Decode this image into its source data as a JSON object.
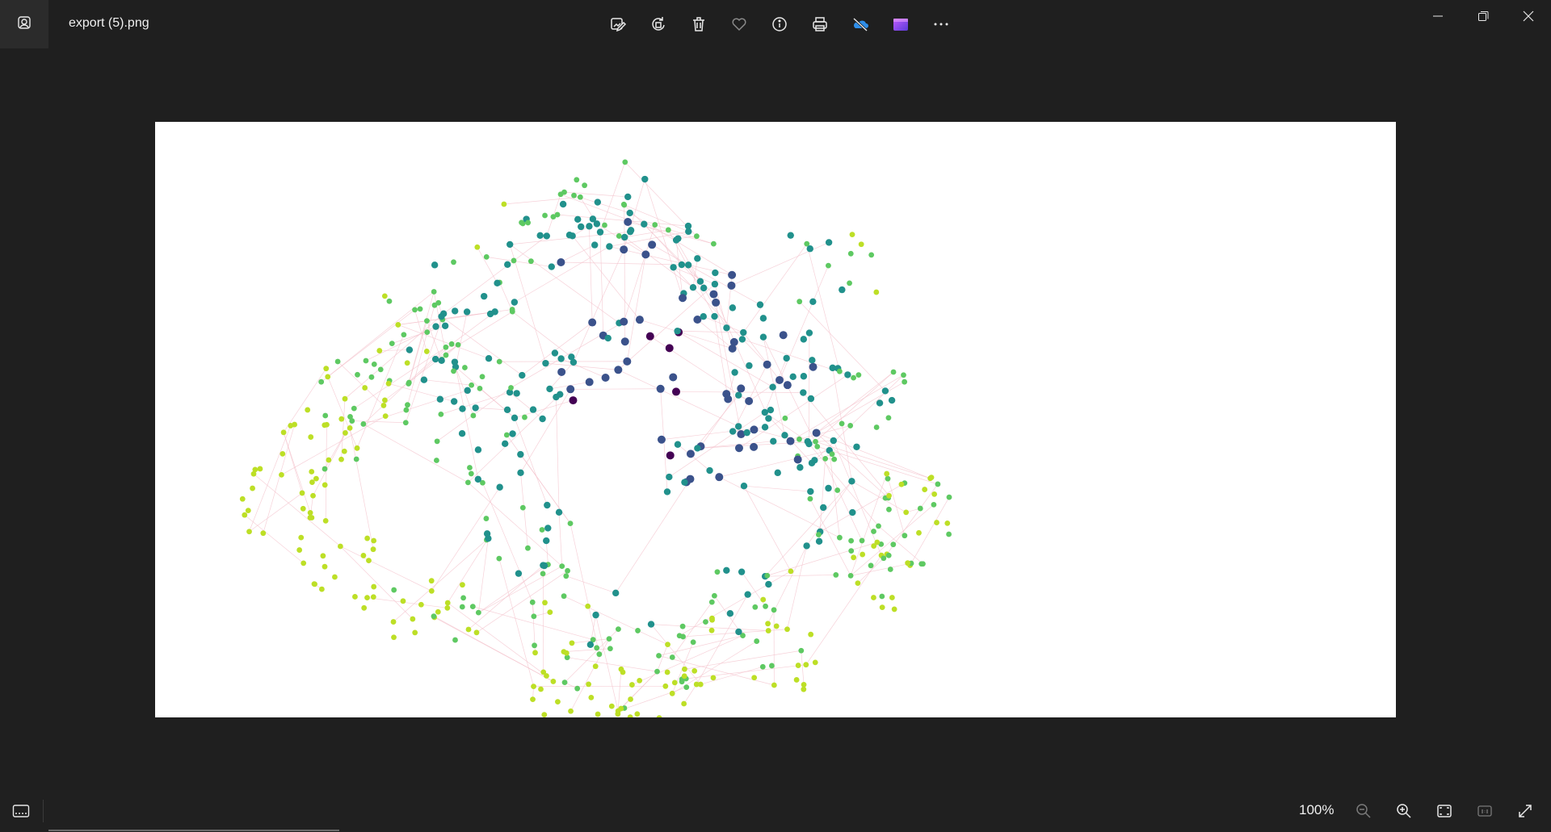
{
  "app": {
    "filename": "export (5).png",
    "icon": "photos-app-icon"
  },
  "toolbar": {
    "items": [
      {
        "name": "edit-image-icon"
      },
      {
        "name": "rotate-icon"
      },
      {
        "name": "delete-icon"
      },
      {
        "name": "favorite-icon"
      },
      {
        "name": "info-icon"
      },
      {
        "name": "print-icon"
      },
      {
        "name": "onedrive-icon"
      },
      {
        "name": "clipchamp-icon"
      },
      {
        "name": "more-options-icon"
      }
    ]
  },
  "window_controls": [
    "minimize-icon",
    "maximize-icon",
    "close-icon"
  ],
  "image": {
    "content": "network graph visualization",
    "node_palette": [
      "#440154",
      "#3b528b",
      "#21918c",
      "#5ec962",
      "#bddf26"
    ],
    "edge_color": "#f4c2cc"
  },
  "bottombar": {
    "zoom_level": "100%",
    "tools": [
      "zoom-out-icon",
      "zoom-in-icon",
      "fit-to-window-icon",
      "actual-size-icon",
      "fullscreen-icon"
    ]
  }
}
